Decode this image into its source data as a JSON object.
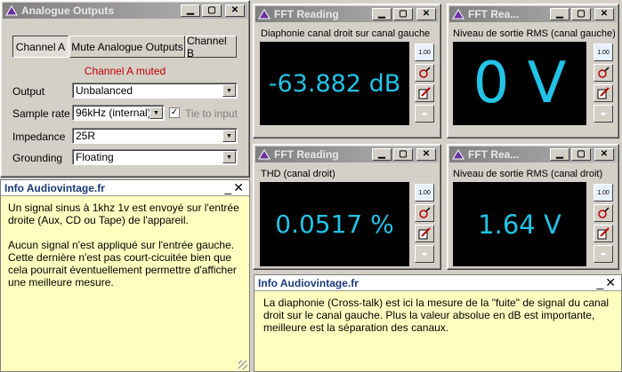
{
  "analogue": {
    "title": "Analogue Outputs",
    "btn_a": "Channel A",
    "btn_mute": "Mute Analogue Outputs",
    "btn_b": "Channel B",
    "muted_text": "Channel A muted",
    "output_label": "Output",
    "output_value": "Unbalanced",
    "sample_label": "Sample rate",
    "sample_value": "96kHz (internal)",
    "tie_label": "Tie to input",
    "impedance_label": "Impedance",
    "impedance_value": "25R",
    "grounding_label": "Grounding",
    "grounding_value": "Floating"
  },
  "info_left": {
    "title": "Info Audiovintage.fr",
    "text": "Un signal sinus à 1khz 1v est envoyé sur l'entrée droite (Aux, CD ou Tape) de l'appareil.\n\nAucun signal n'est appliqué sur l'entrée gauche.\nCette dernière n'est pas court-cicuitée bien que cela pourrait éventuellement permettre d'afficher une meilleure mesure."
  },
  "info_right": {
    "title": "Info Audiovintage.fr",
    "text": "La diaphonie (Cross-talk) est ici la mesure de la \"fuite\" de signal du canal droit sur le canal gauche. Plus la valeur absolue en dB est importante, meilleure est la séparation des canaux."
  },
  "fft1": {
    "title": "FFT Reading",
    "label": "Diaphonie canal droit sur canal gauche",
    "value": "-63.882 dB"
  },
  "fft2": {
    "title": "FFT Rea...",
    "label": "Niveau de sortie RMS (canal gauche)",
    "value": "0 V"
  },
  "fft3": {
    "title": "FFT Reading",
    "label": "THD (canal droit)",
    "value": "0.0517 %"
  },
  "fft4": {
    "title": "FFT Rea...",
    "label": "Niveau de sortie RMS (canal droit)",
    "value": "1.64 V"
  },
  "side_buttons": {
    "digits": "1.00"
  },
  "colors": {
    "display_text": "#22c3e6",
    "display_bg": "#000000",
    "info_bg": "#ffffc0",
    "muted": "#c00000"
  }
}
